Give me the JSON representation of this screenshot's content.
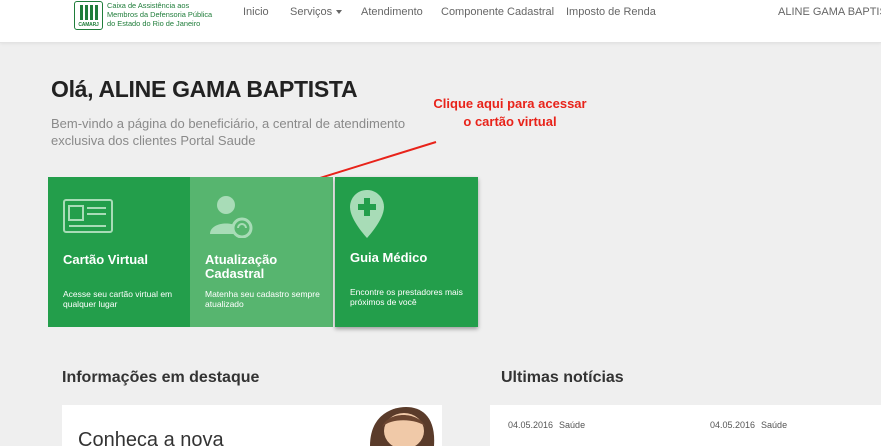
{
  "header": {
    "logo_text": "Caixa de Assistência aos Membros da Defensoria Pública do Estado do Rio de Janeiro",
    "logo_mark_label": "CAMARJ",
    "nav": [
      {
        "label": "Inicio"
      },
      {
        "label": "Serviços"
      },
      {
        "label": "Atendimento"
      },
      {
        "label": "Componente Cadastral"
      },
      {
        "label": "Imposto de Renda"
      }
    ],
    "user_name": "ALINE GAMA BAPTISTA"
  },
  "hero": {
    "greeting": "Olá, ALINE GAMA BAPTISTA",
    "welcome": "Bem-vindo a página do beneficiário, a central de atendimento exclusiva dos clientes Portal Saude"
  },
  "annotation": {
    "text": "Clique aqui para acessar o cartão virtual",
    "color": "#e8231a"
  },
  "tiles": [
    {
      "title": "Cartão Virtual",
      "desc": "Acesse seu cartão virtual em qualquer lugar",
      "icon": "id-card-icon"
    },
    {
      "title": "Atualização Cadastral",
      "desc": "Matenha seu cadastro sempre atualizado",
      "icon": "user-sync-icon"
    },
    {
      "title": "Guia Médico",
      "desc": "Encontre os prestadores mais próximos de você",
      "icon": "map-pin-plus-icon"
    }
  ],
  "sections": {
    "highlights_title": "Informações em destaque",
    "news_title": "Ultimas notícias"
  },
  "promo": {
    "text": "Conheça a nova"
  },
  "news": [
    {
      "date": "04.05.2016",
      "category": "Saúde"
    },
    {
      "date": "04.05.2016",
      "category": "Saúde"
    }
  ],
  "colors": {
    "brand_green": "#239e4b",
    "light_green": "#57b56f",
    "logo_green": "#1f7d3a"
  }
}
